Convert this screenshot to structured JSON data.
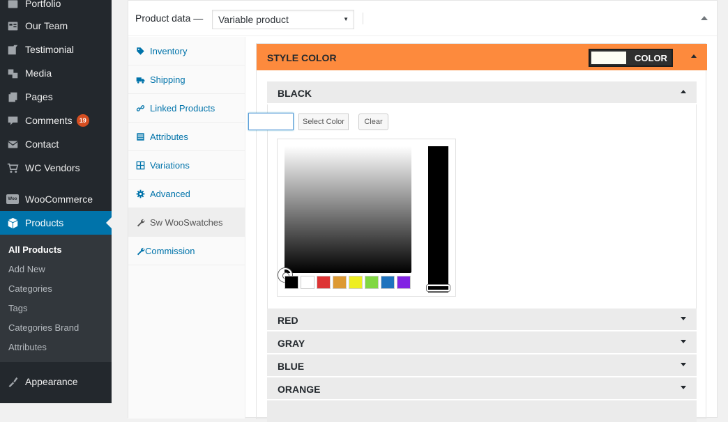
{
  "sidebar": {
    "items": [
      {
        "label": "Portfolio",
        "icon": "portfolio-icon"
      },
      {
        "label": "Our Team",
        "icon": "team-icon"
      },
      {
        "label": "Testimonial",
        "icon": "testimonial-icon"
      },
      {
        "label": "Media",
        "icon": "media-icon"
      },
      {
        "label": "Pages",
        "icon": "pages-icon"
      },
      {
        "label": "Comments",
        "icon": "comments-icon",
        "badge": "19"
      },
      {
        "label": "Contact",
        "icon": "mail-icon"
      },
      {
        "label": "WC Vendors",
        "icon": "cart-icon"
      },
      {
        "label": "WooCommerce",
        "icon": "woocommerce-icon"
      },
      {
        "label": "Products",
        "icon": "products-icon"
      },
      {
        "label": "Appearance",
        "icon": "brush-icon"
      }
    ],
    "woo_logo_text": "Woo",
    "submenu": [
      "All Products",
      "Add New",
      "Categories",
      "Tags",
      "Categories Brand",
      "Attributes"
    ]
  },
  "product_data": {
    "label": "Product data —",
    "type_value": "Variable product",
    "tabs": [
      "Inventory",
      "Shipping",
      "Linked Products",
      "Attributes",
      "Variations",
      "Advanced",
      "Sw WooSwatches",
      "Commission"
    ]
  },
  "swatches": {
    "header_title": "STYLE COLOR",
    "header_button_label": "COLOR",
    "swatch_color": "#fdfdf4",
    "open_item": "BLACK",
    "select_color_label": "Select Color",
    "clear_label": "Clear",
    "palette": [
      "#000000",
      "#ffffff",
      "#dd3333",
      "#dd9933",
      "#eeee22",
      "#81d742",
      "#1e73be",
      "#8224e3"
    ],
    "collapsed_items": [
      "RED",
      "GRAY",
      "BLUE",
      "ORANGE"
    ]
  },
  "colors": {
    "accent": "#0073aa",
    "header_orange": "#fd8a3d",
    "sidebar_bg": "#23282d"
  }
}
